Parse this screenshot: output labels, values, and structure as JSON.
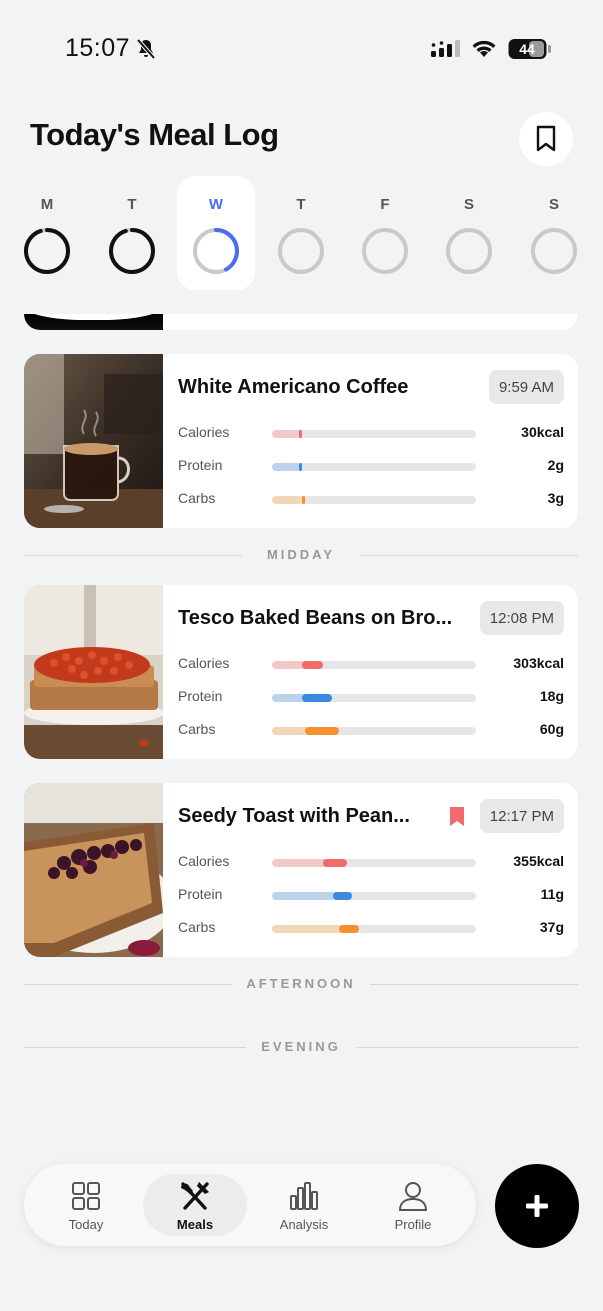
{
  "status_bar": {
    "time": "15:07",
    "battery": "44"
  },
  "header": {
    "title": "Today's Meal Log"
  },
  "week": [
    {
      "label": "M",
      "progress": 0.95,
      "selected": false
    },
    {
      "label": "T",
      "progress": 0.95,
      "selected": false
    },
    {
      "label": "W",
      "progress": 0.42,
      "selected": true
    },
    {
      "label": "T",
      "progress": 0,
      "selected": false
    },
    {
      "label": "F",
      "progress": 0,
      "selected": false
    },
    {
      "label": "S",
      "progress": 0,
      "selected": false
    },
    {
      "label": "S",
      "progress": 0,
      "selected": false
    }
  ],
  "sections": {
    "midday": "MIDDAY",
    "afternoon": "AFTERNOON",
    "evening": "EVENING"
  },
  "meals": [
    {
      "name": "White Americano Coffee",
      "time": "9:59 AM",
      "bookmarked": false,
      "calories": "30kcal",
      "protein": "2g",
      "carbs": "3g"
    },
    {
      "name": "Tesco Baked Beans on Bro...",
      "time": "12:08 PM",
      "bookmarked": false,
      "calories": "303kcal",
      "protein": "18g",
      "carbs": "60g"
    },
    {
      "name": "Seedy Toast with Pean...",
      "time": "12:17 PM",
      "bookmarked": true,
      "calories": "355kcal",
      "protein": "11g",
      "carbs": "37g"
    }
  ],
  "nutrient_labels": {
    "calories": "Calories",
    "protein": "Protein",
    "carbs": "Carbs"
  },
  "colors": {
    "calories": "#f26b6b",
    "calories_prev": "#f2c9c9",
    "protein": "#3a8be0",
    "protein_prev": "#bcd3ec",
    "carbs": "#f5902e",
    "carbs_prev": "#f2d6b8",
    "accent": "#4a6cf7"
  },
  "nav": {
    "tabs": [
      {
        "label": "Today",
        "icon": "grid-icon"
      },
      {
        "label": "Meals",
        "icon": "fork-knife-icon"
      },
      {
        "label": "Analysis",
        "icon": "bar-chart-icon"
      },
      {
        "label": "Profile",
        "icon": "person-icon"
      }
    ],
    "active": "Meals",
    "add_icon": "plus-icon"
  }
}
